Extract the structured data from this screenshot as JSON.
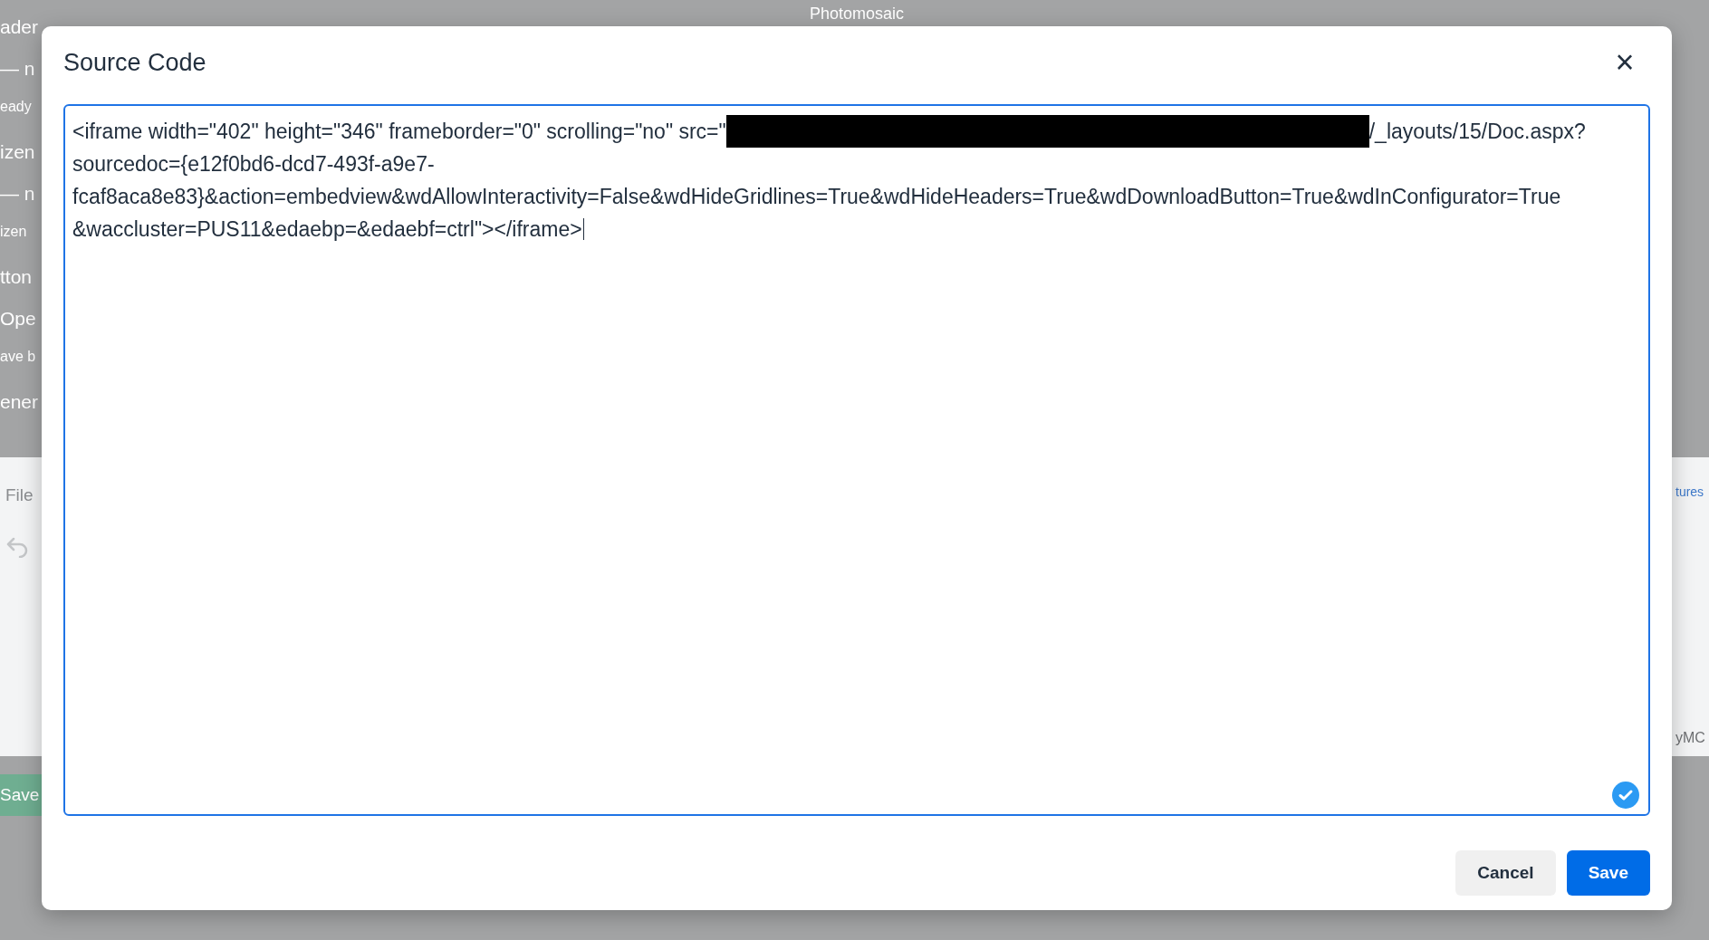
{
  "background": {
    "top_heading": "Photomosaic",
    "left_items": [
      {
        "text": "ader",
        "kind": "label"
      },
      {
        "text": "— n",
        "kind": "label"
      },
      {
        "text": "eady",
        "kind": "note"
      },
      {
        "text": "izen",
        "kind": "label"
      },
      {
        "text": "— n",
        "kind": "label"
      },
      {
        "text": "izen",
        "kind": "note"
      },
      {
        "text": "tton",
        "kind": "label"
      },
      {
        "text": "Ope",
        "kind": "label"
      },
      {
        "text": "ave b",
        "kind": "note"
      },
      {
        "text": "ener",
        "kind": "label"
      }
    ],
    "left_tab": "File",
    "left_button": "Save",
    "right_tab": "tures",
    "right_footer": "yMC"
  },
  "dialog": {
    "title": "Source Code",
    "close": "×",
    "code": {
      "first_line_start": "<iframe width=\"402\" height=\"346\" frameborder=\"0\" scrolling=\"no\" src=\"",
      "first_line_end": "/_layouts/15/Doc.aspx?",
      "lines": [
        "sourcedoc={e12f0bd6-dcd7-493f-a9e7-",
        "fcaf8aca8e83}&action=embedview&wdAllowInteractivity=False&wdHideGridlines=True&wdHideHeaders=True&wdDownloadButton=True&wdInConfigurator=True",
        "&waccluster=PUS11&edaebp=&edaebf=ctrl\"></iframe>"
      ]
    },
    "valid": true,
    "buttons": [
      {
        "label": "Cancel",
        "kind": "secondary"
      },
      {
        "label": "Save",
        "kind": "primary"
      }
    ]
  }
}
